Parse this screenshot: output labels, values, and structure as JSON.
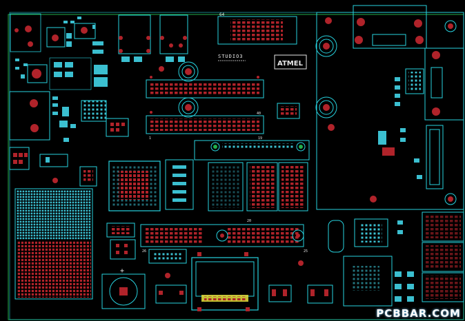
{
  "watermark": "PCBBAR.COM",
  "silkscreen": {
    "board_name": "STUDIO3",
    "logo_text": "ATMEL",
    "header1_pin_top": "64",
    "header1_pin_a": "40",
    "header1_pin_b": "1",
    "header1_pin_c": "19",
    "header2_pin_a": "20",
    "header2_pin_b": "25",
    "header2_pin_c": "26"
  },
  "colors": {
    "outline": "#27d3e0",
    "pad_red": "#b0232a",
    "pad_cyan": "#3bbfd0",
    "text": "#e8e8e8",
    "green_frame": "#22b14c",
    "yellow": "#e8e03a"
  }
}
